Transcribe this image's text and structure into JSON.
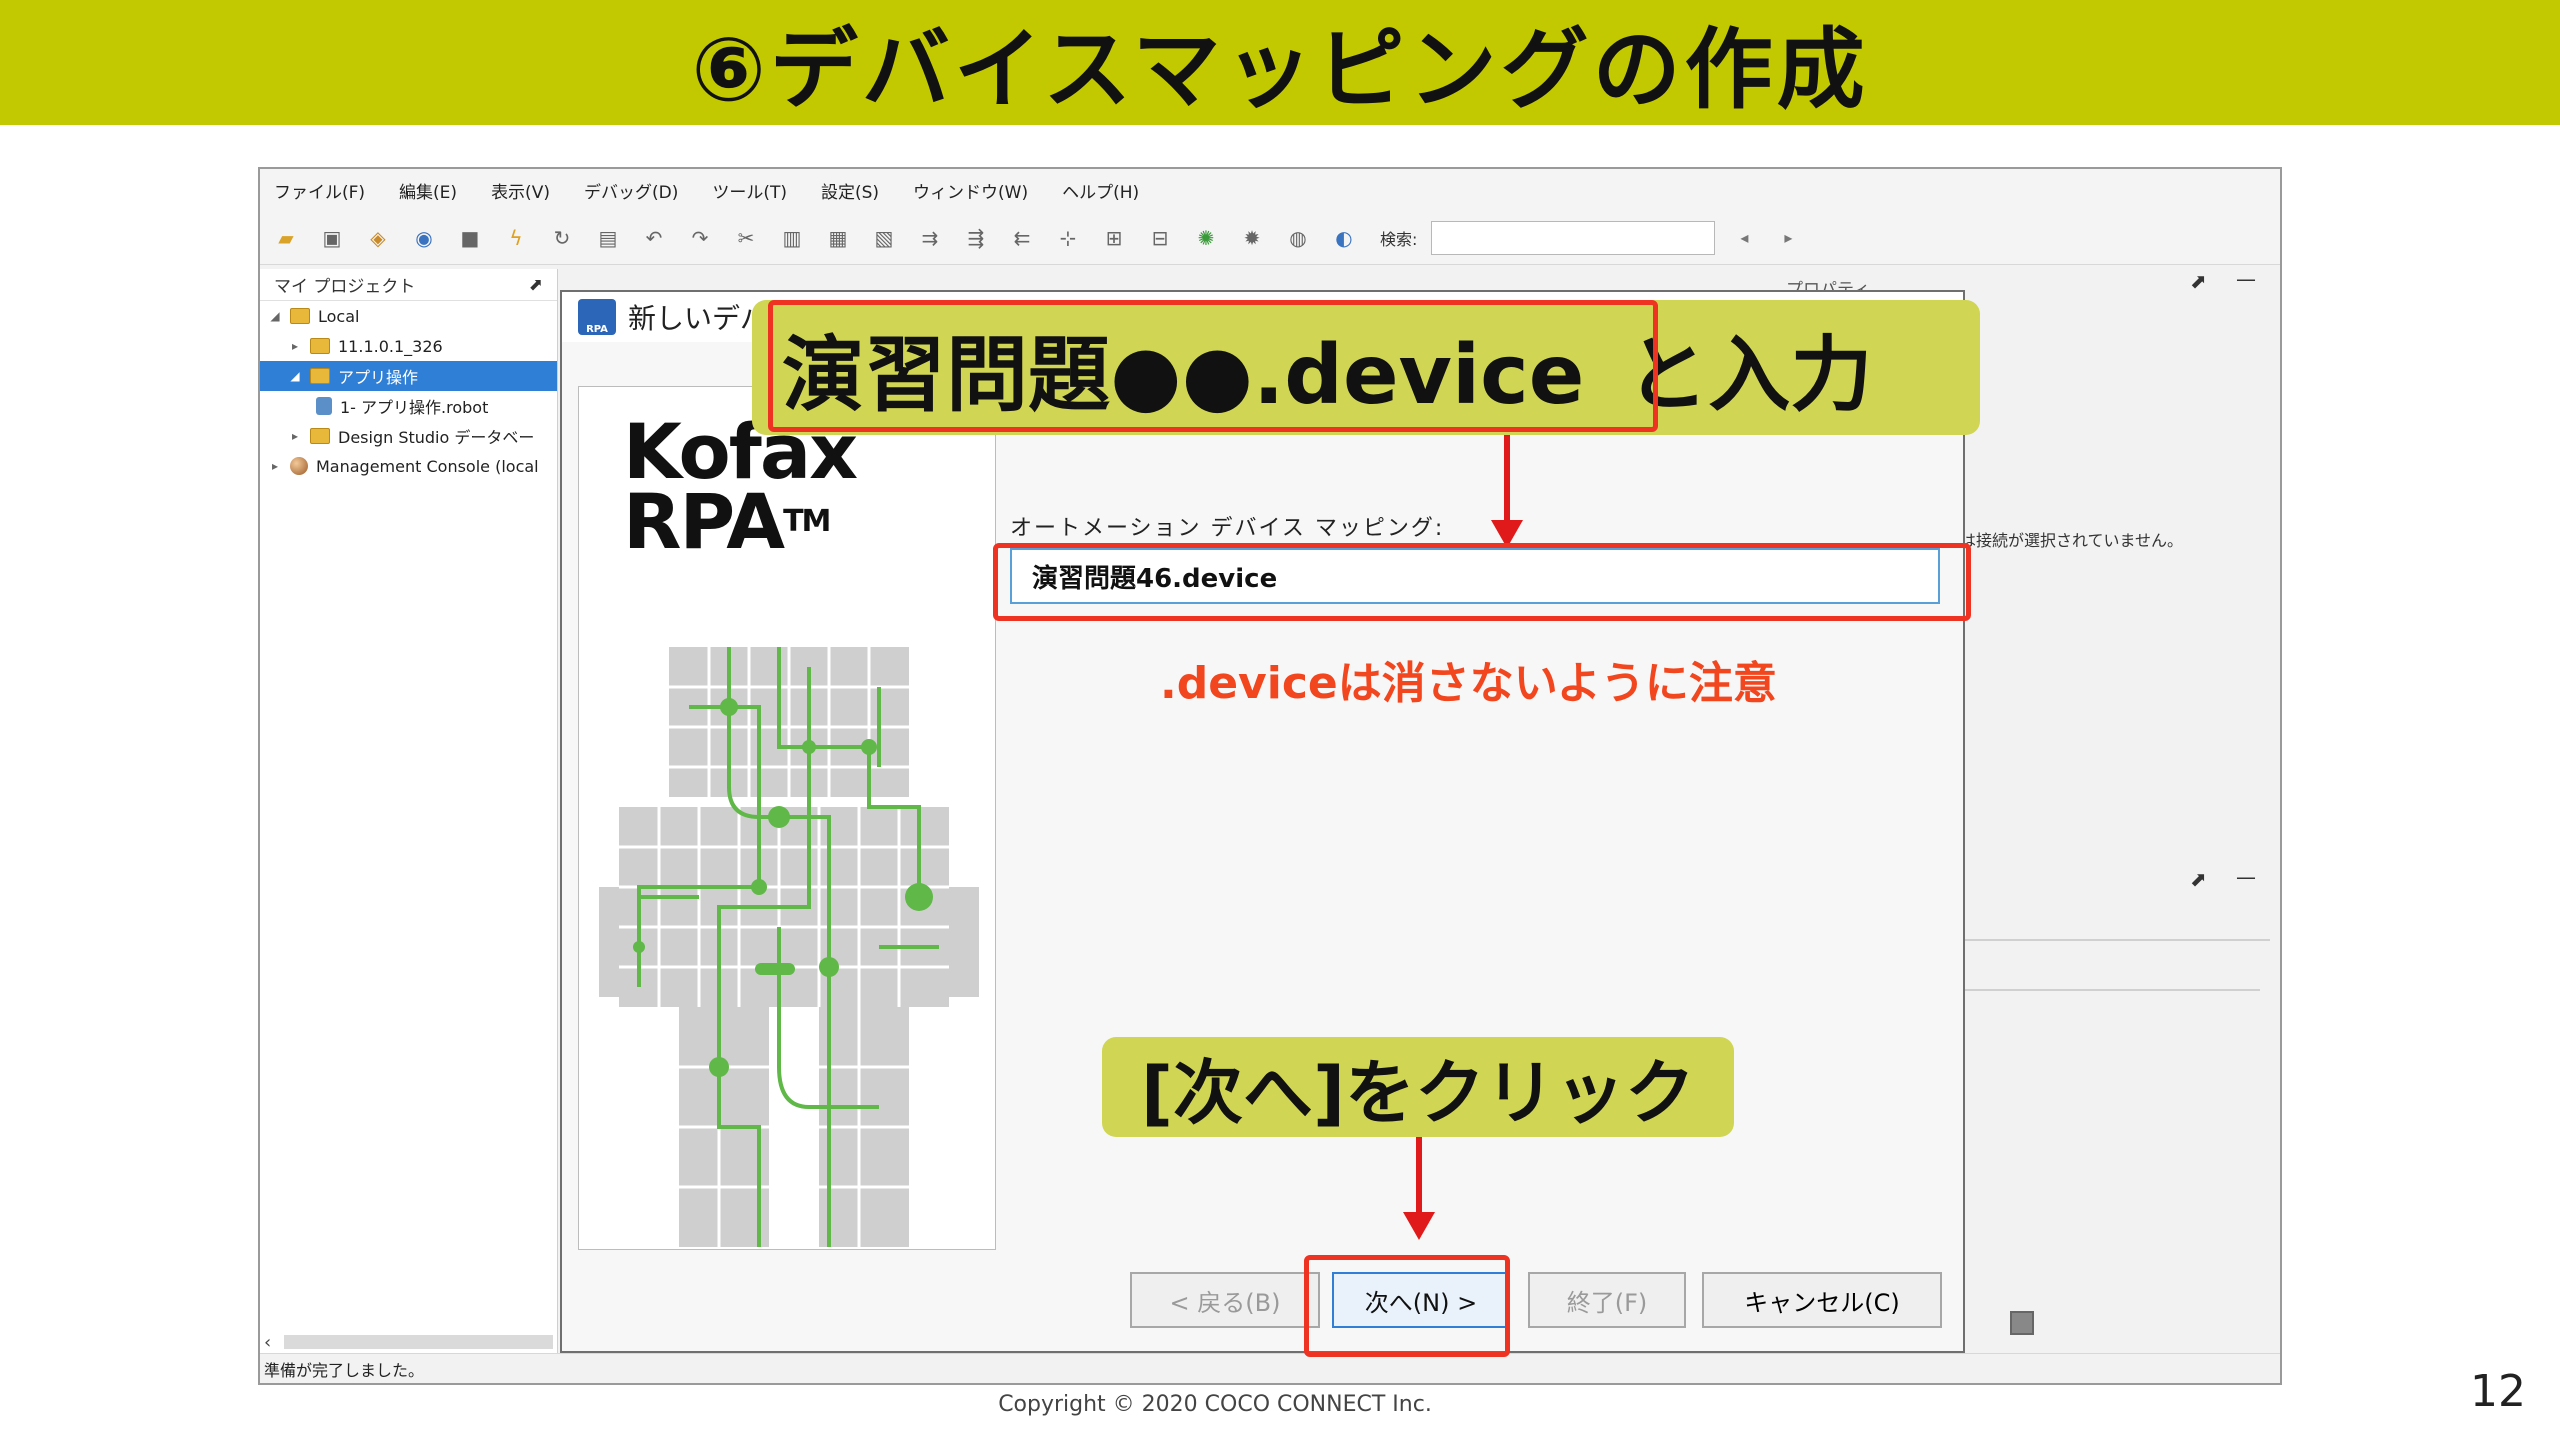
{
  "slide": {
    "title": "⑥デバイスマッピングの作成",
    "copyright": "Copyright © 2020 COCO CONNECT Inc.",
    "page_number": "12"
  },
  "app": {
    "menus": [
      "ファイル(F)",
      "編集(E)",
      "表示(V)",
      "デバッグ(D)",
      "ツール(T)",
      "設定(S)",
      "ウィンドウ(W)",
      "ヘルプ(H)"
    ],
    "toolbar_icons": [
      "open-icon",
      "save-icon",
      "save-all-icon",
      "new-robot-icon",
      "stop-icon",
      "run-icon",
      "refresh-icon",
      "copy-icon",
      "undo-icon",
      "redo-icon",
      "cut-icon",
      "paste-icon",
      "delete-icon",
      "move-icon",
      "step-icon",
      "step-over-icon",
      "step-back-icon",
      "zoom-icon",
      "expand-icon",
      "collapse-icon",
      "debug-icon",
      "bug-icon",
      "globe-icon",
      "web-icon"
    ],
    "search_label": "検索:",
    "search_value": "",
    "project_panel": {
      "title": "マイ プロジェクト",
      "tree": [
        {
          "label": "Local",
          "arrow": "◢",
          "icon": "folder"
        },
        {
          "label": "11.1.0.1_326",
          "arrow": "▸",
          "icon": "folder"
        },
        {
          "label": "アプリ操作",
          "arrow": "◢",
          "icon": "folder",
          "selected": true
        },
        {
          "label": "1- アプリ操作.robot",
          "arrow": "",
          "icon": "robot"
        },
        {
          "label": "Design Studio データベー",
          "arrow": "▸",
          "icon": "folder"
        },
        {
          "label": "Management Console (local",
          "arrow": "▸",
          "icon": "globe"
        }
      ]
    },
    "properties_title": "プロパティ",
    "properties_message": "は接続が選択されていません。",
    "status": "準備が完了しました。"
  },
  "dialog": {
    "title": "新しいデバ",
    "brand_line1": "Kofax",
    "brand_line2": "RPA",
    "brand_tm": "TM",
    "field_label": "オートメーション デバイス マッピング:",
    "field_value": "演習問題46.device",
    "buttons": {
      "back": "< 戻る(B)",
      "next": "次へ(N) >",
      "finish": "終了(F)",
      "cancel": "キャンセル(C)"
    }
  },
  "annotations": {
    "input_callout_highlight": "演習問題●●.device",
    "input_callout_suffix": "と入力",
    "note": ".deviceは消さないように注意",
    "next_callout": "[次へ]をクリック"
  },
  "colors": {
    "header_bg": "#c2c900",
    "callout_bg": "#d0d653",
    "annotation_red": "#ef3322",
    "note_text": "#f2461f"
  }
}
